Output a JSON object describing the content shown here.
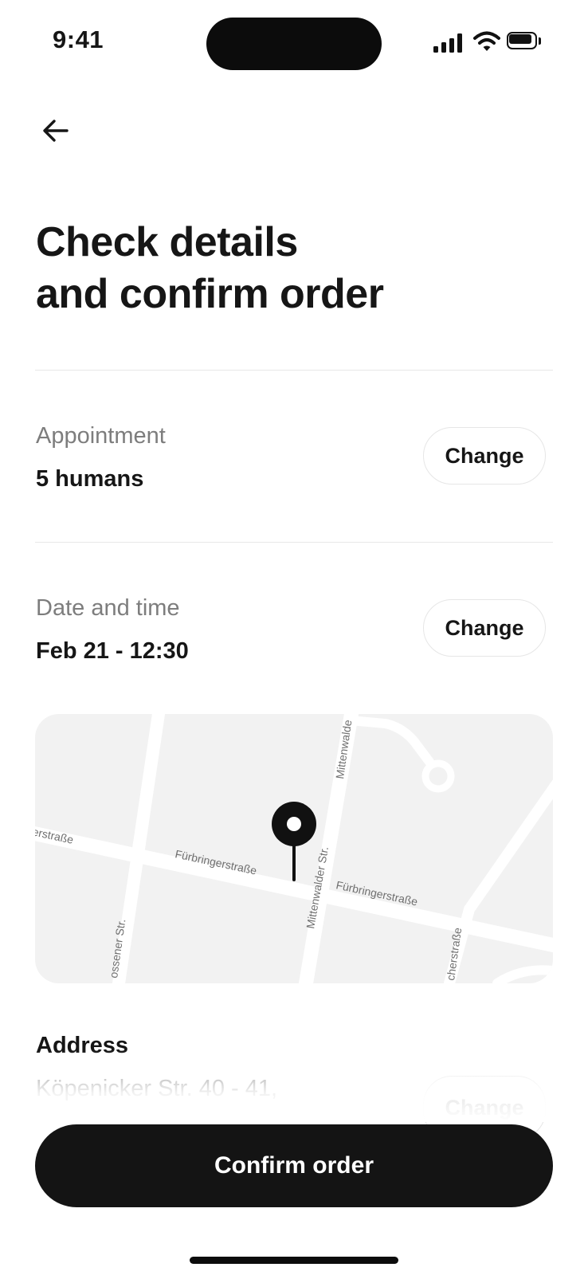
{
  "status_bar": {
    "time": "9:41"
  },
  "page": {
    "title_line1": "Check details",
    "title_line2": "and confirm order"
  },
  "appointment": {
    "label": "Appointment",
    "value": "5 humans",
    "change_label": "Change"
  },
  "date_time": {
    "label": "Date and time",
    "value": "Feb 21 - 12:30",
    "change_label": "Change"
  },
  "map": {
    "streets": {
      "fuerbringer_left": "erstraße",
      "fuerbringer_mid": "Fürbringerstraße",
      "fuerbringer_right": "Fürbringerstraße",
      "mittenwalder": "Mittenwalder Str.",
      "mittenwalder_top": "Mittenwalde",
      "zossener": "ossener Str.",
      "right_street": "cherstraße"
    },
    "pin_icon": "location-pin-icon"
  },
  "address": {
    "title": "Address",
    "line1": "Köpenicker Str. 40 - 41,",
    "change_label": "Change"
  },
  "footer": {
    "confirm_label": "Confirm order"
  },
  "colors": {
    "primary": "#141414",
    "muted": "#7d7d7d",
    "map_bg": "#f2f2f2",
    "divider": "#e8e8e8"
  }
}
